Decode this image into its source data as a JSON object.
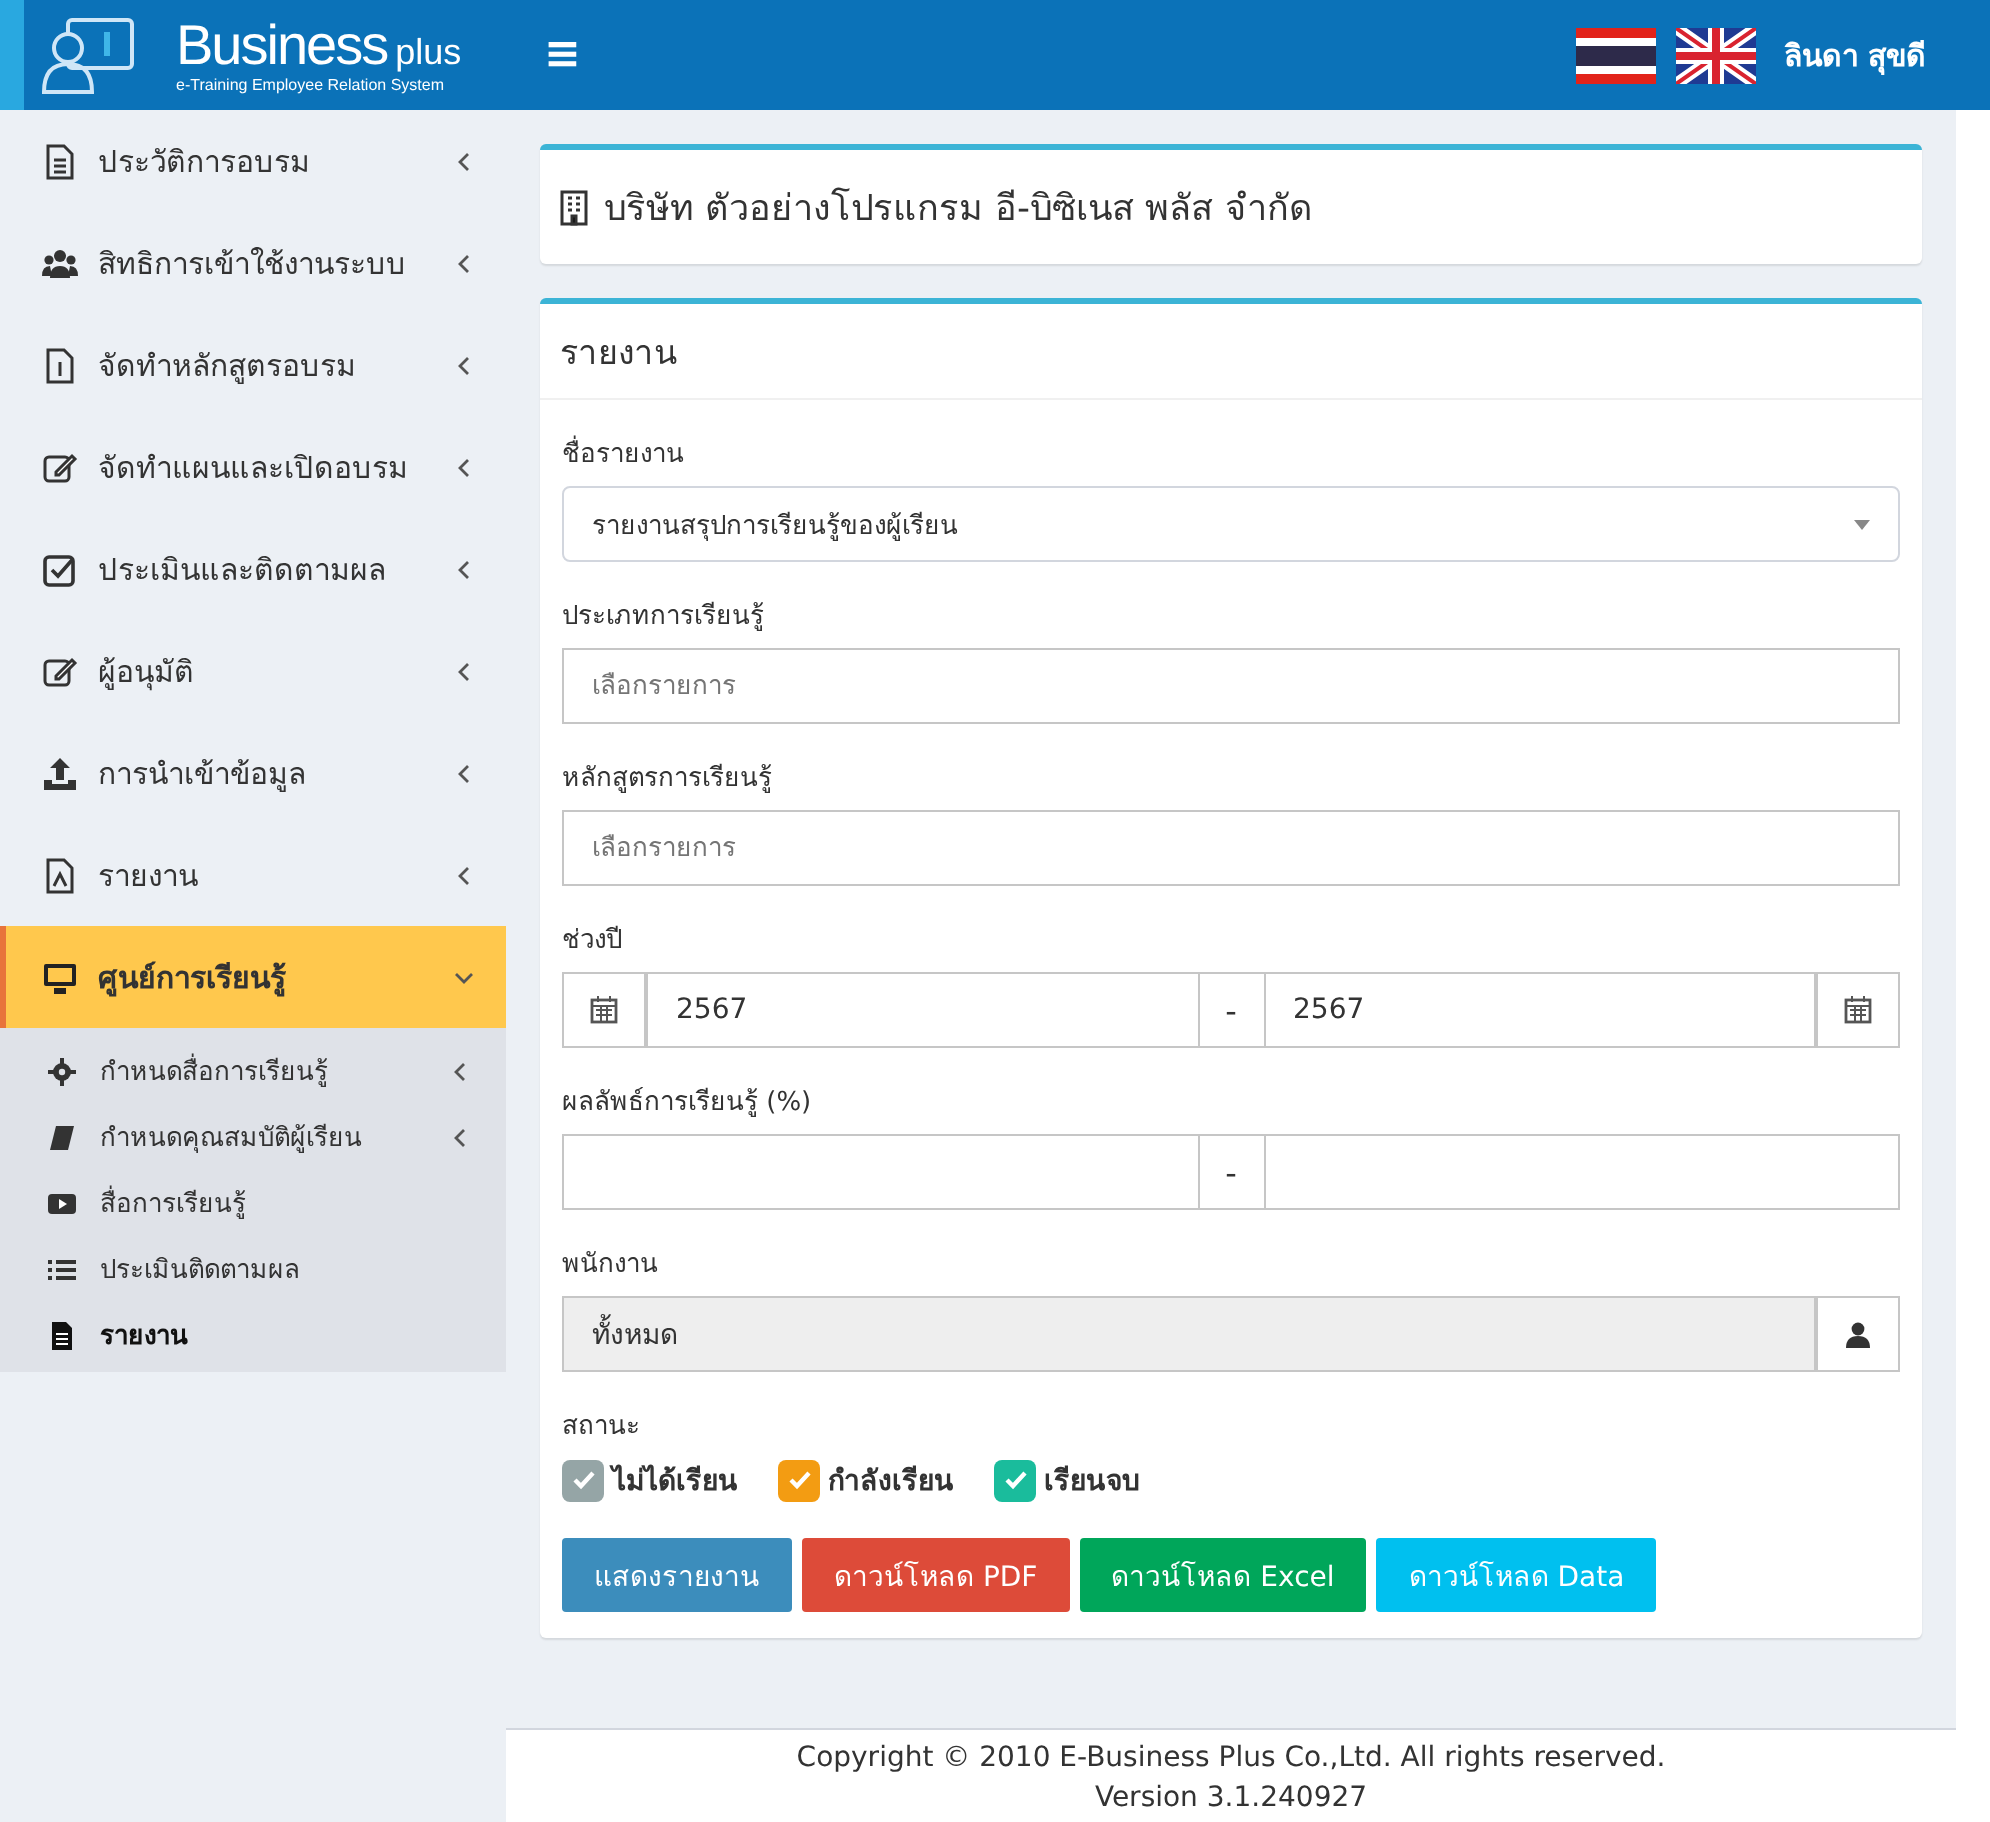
{
  "header": {
    "logo_title": "Business",
    "logo_suffix": "plus",
    "logo_subtitle": "e-Training Employee Relation System",
    "menu_glyph": "≡",
    "user_name": "ลินดา สุขดี"
  },
  "sidebar": {
    "items": [
      {
        "label": "ประวัติการอบรม",
        "selected": false,
        "expanded": false
      },
      {
        "label": "สิทธิการเข้าใช้งานระบบ",
        "selected": false,
        "expanded": false
      },
      {
        "label": "จัดทำหลักสูตรอบรม",
        "selected": false,
        "expanded": false
      },
      {
        "label": "จัดทำแผนและเปิดอบรม",
        "selected": false,
        "expanded": false
      },
      {
        "label": "ประเมินและติดตามผล",
        "selected": false,
        "expanded": false
      },
      {
        "label": "ผู้อนุมัติ",
        "selected": false,
        "expanded": false
      },
      {
        "label": "การนำเข้าข้อมูล",
        "selected": false,
        "expanded": false
      },
      {
        "label": "รายงาน",
        "selected": false,
        "expanded": false
      },
      {
        "label": "ศูนย์การเรียนรู้",
        "selected": true,
        "expanded": true,
        "children": [
          {
            "label": "กำหนดสื่อการเรียนรู้",
            "selected": false,
            "has_submenu": true
          },
          {
            "label": "กำหนดคุณสมบัติผู้เรียน",
            "selected": false,
            "has_submenu": true
          },
          {
            "label": "สื่อการเรียนรู้",
            "selected": false,
            "has_submenu": false
          },
          {
            "label": "ประเมินติดตามผล",
            "selected": false,
            "has_submenu": false
          },
          {
            "label": "รายงาน",
            "selected": true,
            "has_submenu": false
          }
        ]
      }
    ]
  },
  "company_box": {
    "title": "บริษัท ตัวอย่างโปรแกรม อี-บิซิเนส พลัส จำกัด"
  },
  "report_box": {
    "title": "รายงาน",
    "report_name": {
      "label": "ชื่อรายงาน",
      "value": "รายงานสรุปการเรียนรู้ของผู้เรียน"
    },
    "learning_type": {
      "label": "ประเภทการเรียนรู้",
      "placeholder": "เลือกรายการ"
    },
    "course": {
      "label": "หลักสูตรการเรียนรู้",
      "placeholder": "เลือกรายการ"
    },
    "year_range": {
      "label": "ช่วงปี",
      "from": "2567",
      "separator": "-",
      "to": "2567"
    },
    "result_range": {
      "label": "ผลลัพธ์การเรียนรู้ (%)",
      "separator": "-"
    },
    "employee": {
      "label": "พนักงาน",
      "value": "ทั้งหมด",
      "disabled": true
    },
    "status": {
      "label": "สถานะ",
      "options": [
        {
          "label": "ไม่ได้เรียน",
          "checked": true,
          "color": "#95a5a6"
        },
        {
          "label": "กำลังเรียน",
          "checked": true,
          "color": "#f39c12"
        },
        {
          "label": "เรียนจบ",
          "checked": true,
          "color": "#1abc9c"
        }
      ]
    },
    "buttons": [
      {
        "label": "แสดงรายงาน",
        "color": "#3c8dbc"
      },
      {
        "label": "ดาวน์โหลด PDF",
        "color": "#dd4b39"
      },
      {
        "label": "ดาวน์โหลด Excel",
        "color": "#00a65a"
      },
      {
        "label": "ดาวน์โหลด Data",
        "color": "#00c0ef"
      }
    ]
  },
  "footer": {
    "copyright": "Copyright © 2010 E-Business Plus Co.,Ltd. All rights reserved.",
    "version": "Version 3.1.240927"
  }
}
